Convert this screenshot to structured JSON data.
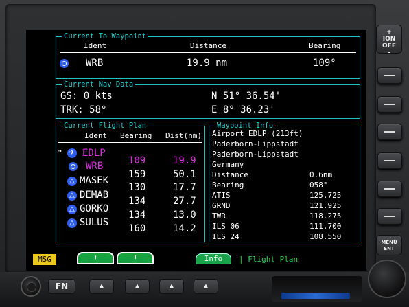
{
  "colors": {
    "accent": "#1ac3c3",
    "active": "#e030e0",
    "msg": "#e8c81a",
    "softkey": "#17a23f"
  },
  "power_button": {
    "top": "+",
    "on_label": "ION",
    "off_label": "OFF",
    "bottom": "-"
  },
  "menu_button": {
    "line1": "MENU",
    "line2": "ENT"
  },
  "fn_button": {
    "label": "FN"
  },
  "current_to": {
    "title": "Current To Waypoint",
    "headers": {
      "ident": "Ident",
      "distance": "Distance",
      "bearing": "Bearing"
    },
    "ident": "WRB",
    "distance": "19.9 nm",
    "bearing": "109°",
    "icon": "vor-waypoint-icon"
  },
  "nav_data": {
    "title": "Current Nav Data",
    "gs": "GS: 0 kts",
    "trk": "TRK: 58°",
    "lat": "N 51° 36.54'",
    "lon": "E 8° 36.23'"
  },
  "flight_plan": {
    "title": "Current Flight Plan",
    "headers": {
      "ident": "Ident",
      "bearing": "Bearing",
      "dist": "Dist(nm)"
    },
    "rows": [
      {
        "ident": "EDLP",
        "bearing": "109",
        "dist": "19.9",
        "icon": "airport-icon",
        "active": true,
        "current": true
      },
      {
        "ident": "WRB",
        "bearing": "159",
        "dist": "50.1",
        "icon": "vor-waypoint-icon",
        "active": true,
        "current": false
      },
      {
        "ident": "MASEK",
        "bearing": "130",
        "dist": "17.7",
        "icon": "intersection-icon",
        "active": false,
        "current": false
      },
      {
        "ident": "DEMAB",
        "bearing": "134",
        "dist": "27.7",
        "icon": "intersection-icon",
        "active": false,
        "current": false
      },
      {
        "ident": "GORKO",
        "bearing": "134",
        "dist": "13.0",
        "icon": "intersection-icon",
        "active": false,
        "current": false
      },
      {
        "ident": "SULUS",
        "bearing": "160",
        "dist": "14.2",
        "icon": "intersection-icon",
        "active": false,
        "current": false
      }
    ]
  },
  "waypoint_info": {
    "title": "Waypoint Info",
    "header_lines": [
      "Airport EDLP (213ft)",
      "Paderborn-Lippstadt",
      "Paderborn-Lippstadt",
      "Germany"
    ],
    "rows": [
      {
        "label": "Distance",
        "value": "0.6nm"
      },
      {
        "label": "Bearing",
        "value": "058°"
      },
      {
        "label": "ATIS",
        "value": "125.725"
      },
      {
        "label": "GRND",
        "value": "121.925"
      },
      {
        "label": "TWR",
        "value": "118.275"
      },
      {
        "label": "ILS 06",
        "value": "111.700"
      },
      {
        "label": "ILS 24",
        "value": "108.550"
      }
    ]
  },
  "softkeys": {
    "msg": "MSG",
    "up_arrow": "⬆",
    "down_arrow": "⬇",
    "info": "Info",
    "flight_plan": "| Flight Plan"
  }
}
